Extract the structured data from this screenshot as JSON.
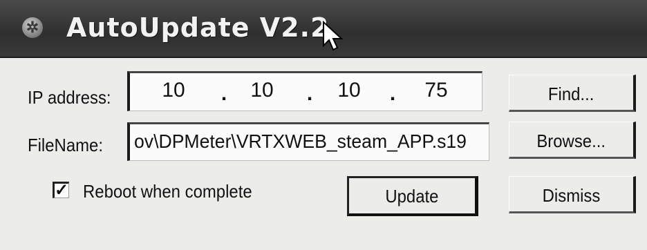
{
  "window": {
    "title": "AutoUpdate V2.2",
    "icon": "app-icon"
  },
  "ip": {
    "label": "IP address:",
    "octets": [
      "10",
      "10",
      "10",
      "75"
    ],
    "separator": "."
  },
  "file": {
    "label": "FileName:",
    "value": "ov\\DPMeter\\VRTXWEB_steam_APP.s19"
  },
  "reboot": {
    "label": "Reboot when complete",
    "checked": true,
    "mark": "✓"
  },
  "buttons": {
    "find": "Find...",
    "browse": "Browse...",
    "update": "Update",
    "dismiss": "Dismiss"
  }
}
